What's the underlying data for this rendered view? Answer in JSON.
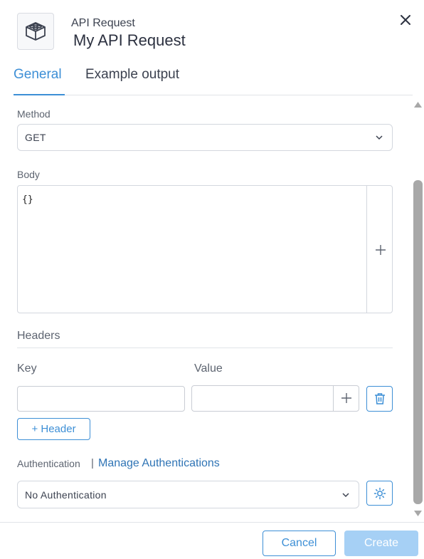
{
  "header": {
    "subtitle": "API Request",
    "title": "My API Request",
    "app_icon": "lego-block-icon",
    "close_icon": "close-icon"
  },
  "tabs": [
    {
      "label": "General",
      "active": true
    },
    {
      "label": "Example output",
      "active": false
    }
  ],
  "method": {
    "label": "Method",
    "value": "GET"
  },
  "body": {
    "label": "Body",
    "value": "{}"
  },
  "headers": {
    "title": "Headers",
    "key_label": "Key",
    "value_label": "Value",
    "key_value": "",
    "value_value": "",
    "add_button": "+ Header"
  },
  "authentication": {
    "label": "Authentication",
    "separator": "|",
    "manage_link": "Manage Authentications",
    "value": "No Authentication"
  },
  "footer": {
    "cancel": "Cancel",
    "create": "Create"
  },
  "colors": {
    "accent": "#3d8fd6",
    "link": "#2f74b5",
    "disabled_primary": "#a6d0f5"
  }
}
